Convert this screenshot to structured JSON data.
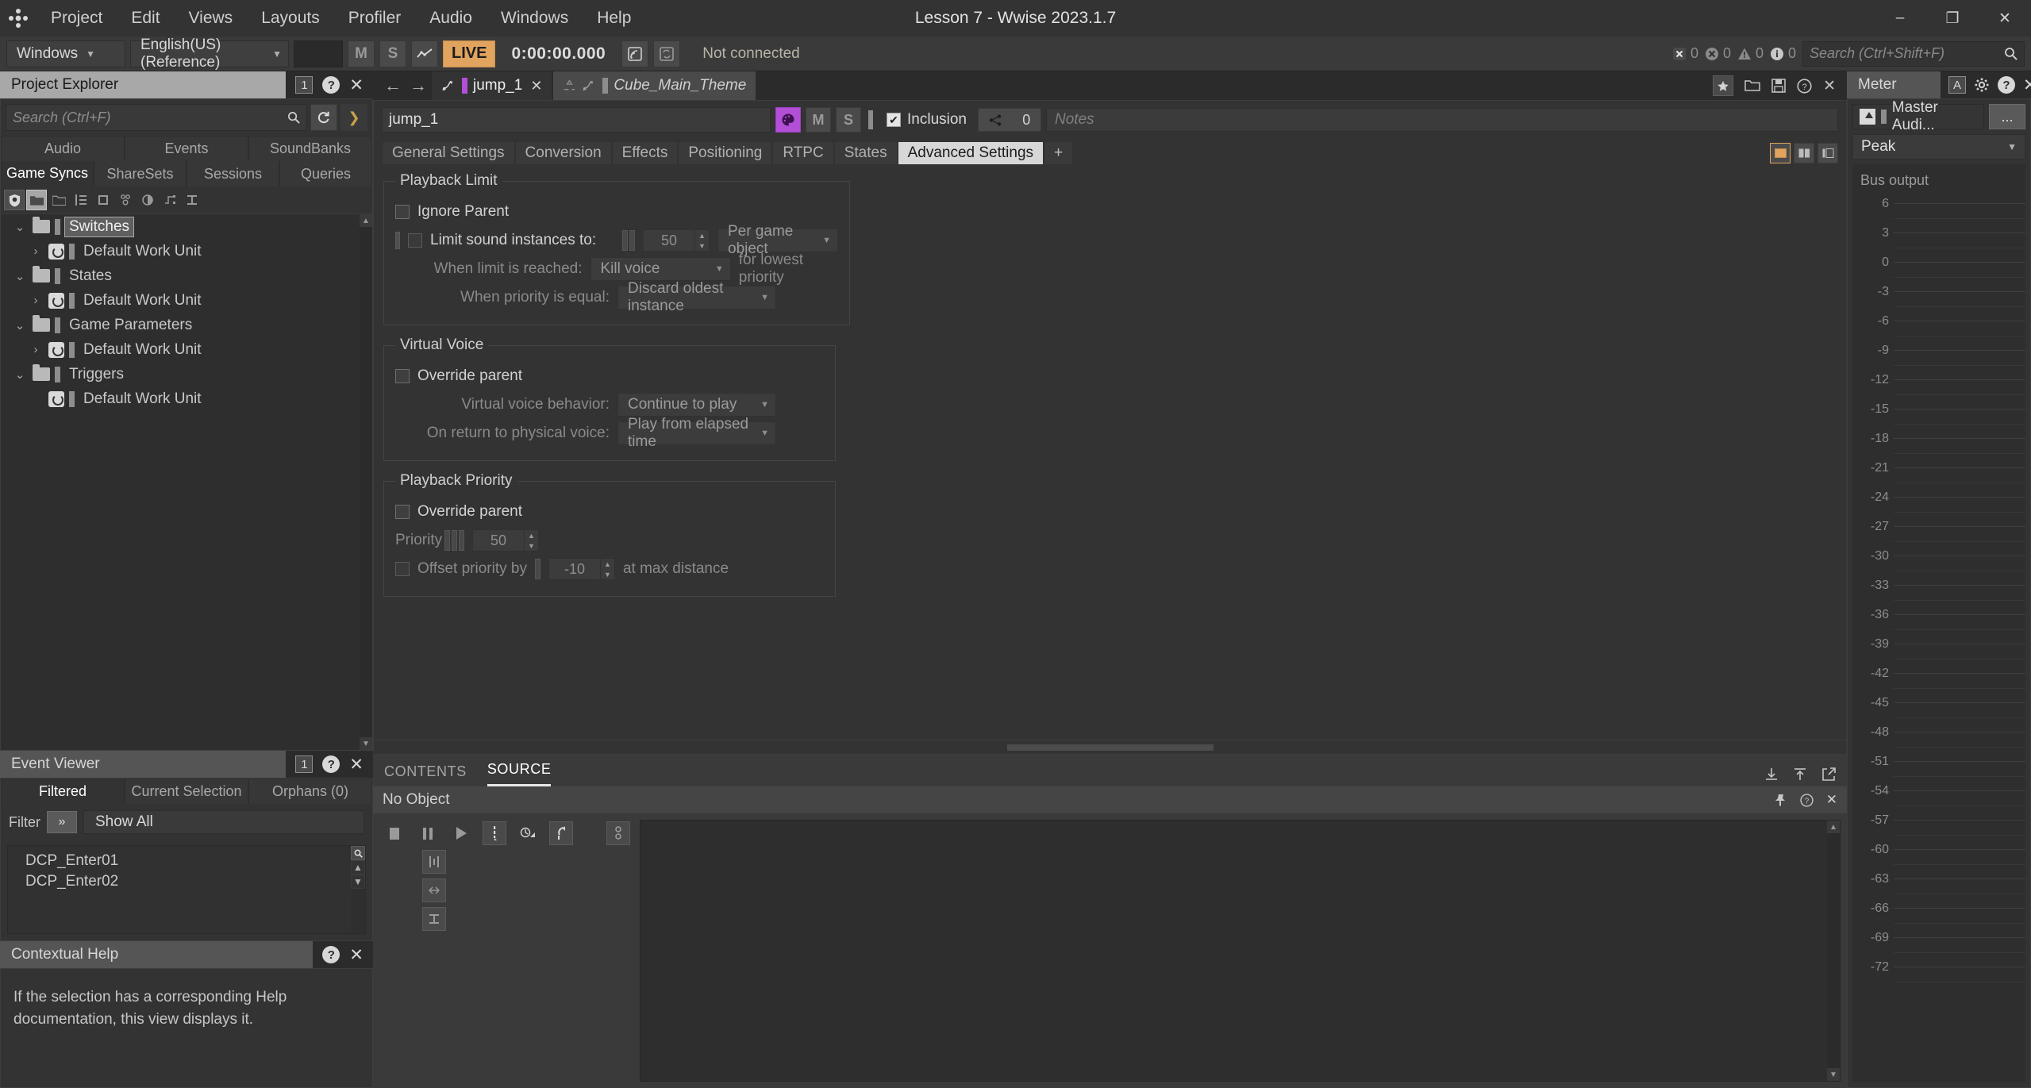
{
  "window": {
    "title": "Lesson 7 - Wwise 2023.1.7",
    "minimize": "–",
    "maximize": "❐",
    "close": "✕"
  },
  "menu": {
    "items": [
      "Project",
      "Edit",
      "Views",
      "Layouts",
      "Profiler",
      "Audio",
      "Windows",
      "Help"
    ]
  },
  "toolbar": {
    "layout_value": "Windows",
    "language_value": "English(US) (Reference)",
    "mute_label": "M",
    "solo_label": "S",
    "profiler_icon": "profiler-graph-icon",
    "live_label": "LIVE",
    "time": "0:00:00.000",
    "remote_icon": "remote-connect-icon",
    "sync_icon": "sync-icon",
    "connection_status": "Not connected",
    "counts": [
      {
        "icon": "error-icon",
        "value": "0"
      },
      {
        "icon": "critical-icon",
        "value": "0"
      },
      {
        "icon": "warning-icon",
        "value": "0"
      },
      {
        "icon": "info-icon",
        "value": "0"
      }
    ],
    "search_placeholder": "Search (Ctrl+Shift+F)"
  },
  "project_explorer": {
    "title": "Project Explorer",
    "badge": "1",
    "search_placeholder": "Search (Ctrl+F)",
    "tabs_row1": [
      "Audio",
      "Events",
      "SoundBanks"
    ],
    "tabs_row2": [
      "Game Syncs",
      "ShareSets",
      "Sessions",
      "Queries"
    ],
    "active_tab": "Game Syncs",
    "tree": [
      {
        "label": "Switches",
        "type": "folder",
        "depth": 0,
        "expander": "⌄",
        "selected": true
      },
      {
        "label": "Default Work Unit",
        "type": "workunit",
        "depth": 1,
        "expander": "›",
        "selected": false
      },
      {
        "label": "States",
        "type": "folder",
        "depth": 0,
        "expander": "⌄",
        "selected": false
      },
      {
        "label": "Default Work Unit",
        "type": "workunit",
        "depth": 1,
        "expander": "›",
        "selected": false
      },
      {
        "label": "Game Parameters",
        "type": "folder",
        "depth": 0,
        "expander": "⌄",
        "selected": false
      },
      {
        "label": "Default Work Unit",
        "type": "workunit",
        "depth": 1,
        "expander": "›",
        "selected": false
      },
      {
        "label": "Triggers",
        "type": "folder",
        "depth": 0,
        "expander": "⌄",
        "selected": false
      },
      {
        "label": "Default Work Unit",
        "type": "workunit",
        "depth": 1,
        "expander": "",
        "selected": false
      }
    ]
  },
  "event_viewer": {
    "title": "Event Viewer",
    "badge": "1",
    "tabs": [
      "Filtered",
      "Current Selection",
      "Orphans (0)"
    ],
    "active_tab": "Filtered",
    "filter_label": "Filter",
    "filter_expand": "»",
    "filter_value": "Show All",
    "items": [
      "DCP_Enter01",
      "DCP_Enter02"
    ]
  },
  "contextual_help": {
    "title": "Contextual Help",
    "text": "If the selection has a corresponding Help documentation, this view displays it."
  },
  "editor": {
    "back_arrow": "←",
    "forward_arrow": "→",
    "tabs": [
      {
        "label": "jump_1",
        "active": true,
        "closable": true,
        "italic": false
      },
      {
        "label": "Cube_Main_Theme",
        "active": false,
        "closable": false,
        "italic": true
      }
    ],
    "object_name": "jump_1",
    "mute_label": "M",
    "solo_label": "S",
    "inclusion_label": "Inclusion",
    "share_count": "0",
    "notes_placeholder": "Notes",
    "prop_tabs": [
      "General Settings",
      "Conversion",
      "Effects",
      "Positioning",
      "RTPC",
      "States",
      "Advanced Settings"
    ],
    "prop_tab_add": "+",
    "active_prop_tab": "Advanced Settings"
  },
  "advanced_settings": {
    "playback_limit": {
      "title": "Playback Limit",
      "ignore_parent": "Ignore Parent",
      "limit_instances_label": "Limit sound instances to:",
      "limit_instances_value": "50",
      "scope_value": "Per game object",
      "when_limit_label": "When limit is reached:",
      "when_limit_value": "Kill voice",
      "when_limit_suffix": "for lowest priority",
      "when_priority_label": "When priority is equal:",
      "when_priority_value": "Discard oldest instance"
    },
    "virtual_voice": {
      "title": "Virtual Voice",
      "override_parent": "Override parent",
      "behavior_label": "Virtual voice behavior:",
      "behavior_value": "Continue to play",
      "return_label": "On return to physical voice:",
      "return_value": "Play from elapsed time"
    },
    "playback_priority": {
      "title": "Playback Priority",
      "override_parent": "Override parent",
      "priority_label": "Priority",
      "priority_value": "50",
      "offset_label": "Offset priority by",
      "offset_value": "-10",
      "offset_suffix": "at max distance"
    }
  },
  "bottom_panel": {
    "tabs": [
      "CONTENTS",
      "SOURCE"
    ],
    "active_tab": "SOURCE",
    "source_header": "No Object",
    "transport": {
      "stop": "stop-icon",
      "pause": "pause-icon",
      "play": "play-icon",
      "cursor": "cursor-icon",
      "loop_range": "loop-range-icon",
      "reverse": "reverse-icon",
      "link": "link-icon",
      "align": "align-icon",
      "fit": "fit-icon",
      "zoom": "zoom-icon"
    }
  },
  "meter": {
    "title": "Meter",
    "badge_a": "A",
    "bus_name": "Master Audi...",
    "more_label": "...",
    "mode_value": "Peak",
    "bus_output_label": "Bus output",
    "scale_labels": [
      "6",
      "3",
      "0",
      "-3",
      "-6",
      "-9",
      "-12",
      "-15",
      "-18",
      "-21",
      "-24",
      "-27",
      "-30",
      "-33",
      "-36",
      "-39",
      "-42",
      "-45",
      "-48",
      "-51",
      "-54",
      "-57",
      "-60",
      "-63",
      "-66",
      "-69",
      "-72"
    ]
  },
  "colors": {
    "accent_orange": "#e0a45e",
    "accent_purple": "#b34fd6",
    "panel_bg": "#333333",
    "app_bg": "#2b2b2b"
  }
}
